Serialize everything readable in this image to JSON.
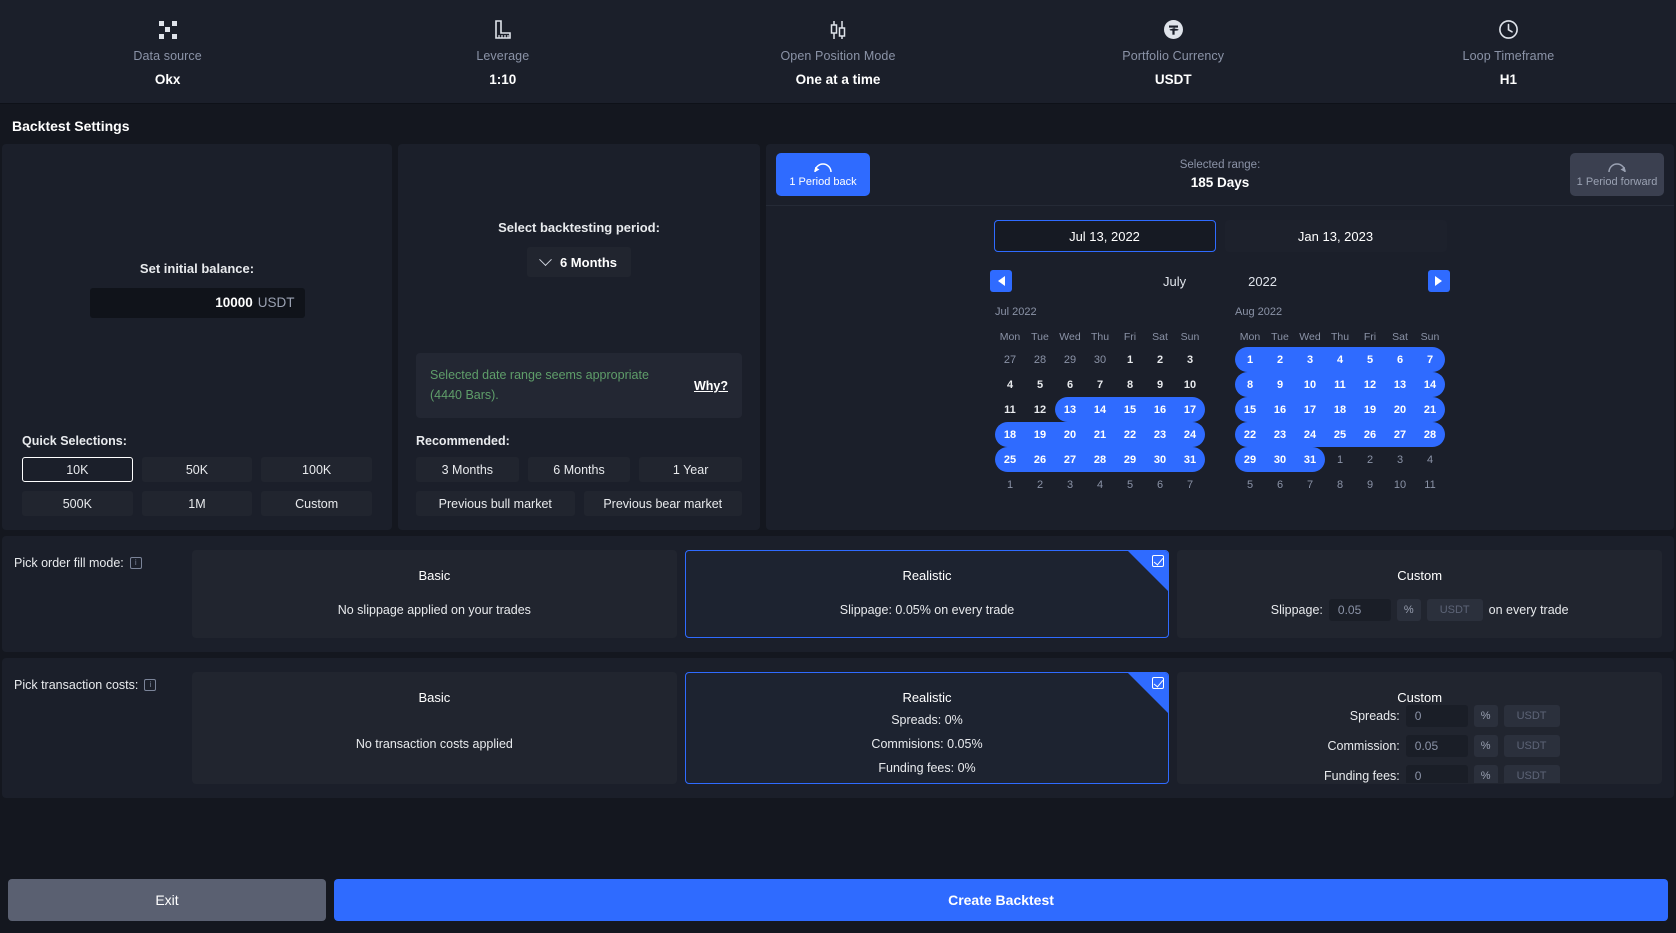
{
  "topbar": {
    "items": [
      {
        "icon": "checkerboard-icon",
        "label": "Data source",
        "value": "Okx"
      },
      {
        "icon": "ruler-icon",
        "label": "Leverage",
        "value": "1:10"
      },
      {
        "icon": "candlestick-icon",
        "label": "Open Position Mode",
        "value": "One at a time"
      },
      {
        "icon": "tether-icon",
        "label": "Portfolio Currency",
        "value": "USDT"
      },
      {
        "icon": "clock-icon",
        "label": "Loop Timeframe",
        "value": "H1"
      }
    ]
  },
  "page_title": "Backtest Settings",
  "balance": {
    "label": "Set initial balance:",
    "value": "10000",
    "currency": "USDT",
    "quick_title": "Quick Selections:",
    "quick_options": [
      "10K",
      "50K",
      "100K",
      "500K",
      "1M",
      "Custom"
    ],
    "selected_quick": "10K"
  },
  "period": {
    "label": "Select backtesting period:",
    "selected": "6 Months",
    "notice_text": "Selected date range seems appropriate (4440 Bars).",
    "notice_link": "Why?",
    "recommended_title": "Recommended:",
    "recommended": [
      "3 Months",
      "6 Months",
      "1 Year",
      "Previous bull market",
      "Previous bear market"
    ]
  },
  "calendar": {
    "period_back": "1 Period back",
    "period_forward": "1 Period forward",
    "range_label": "Selected range:",
    "range_value": "185 Days",
    "start_date": "Jul 13, 2022",
    "end_date": "Jan 13, 2023",
    "nav_month": "July",
    "nav_year": "2022",
    "weekdays": [
      "Mon",
      "Tue",
      "Wed",
      "Thu",
      "Fri",
      "Sat",
      "Sun"
    ],
    "months": [
      {
        "label": "Jul 2022",
        "weeks": [
          [
            {
              "d": "27",
              "s": "dim"
            },
            {
              "d": "28",
              "s": "dim"
            },
            {
              "d": "29",
              "s": "dim"
            },
            {
              "d": "30",
              "s": "dim"
            },
            {
              "d": "1",
              "s": ""
            },
            {
              "d": "2",
              "s": ""
            },
            {
              "d": "3",
              "s": ""
            }
          ],
          [
            {
              "d": "4",
              "s": ""
            },
            {
              "d": "5",
              "s": ""
            },
            {
              "d": "6",
              "s": ""
            },
            {
              "d": "7",
              "s": ""
            },
            {
              "d": "8",
              "s": ""
            },
            {
              "d": "9",
              "s": ""
            },
            {
              "d": "10",
              "s": ""
            }
          ],
          [
            {
              "d": "11",
              "s": ""
            },
            {
              "d": "12",
              "s": ""
            },
            {
              "d": "13",
              "s": "on sleft"
            },
            {
              "d": "14",
              "s": "on"
            },
            {
              "d": "15",
              "s": "on"
            },
            {
              "d": "16",
              "s": "on"
            },
            {
              "d": "17",
              "s": "on sright"
            }
          ],
          [
            {
              "d": "18",
              "s": "on sleft"
            },
            {
              "d": "19",
              "s": "on"
            },
            {
              "d": "20",
              "s": "on"
            },
            {
              "d": "21",
              "s": "on"
            },
            {
              "d": "22",
              "s": "on"
            },
            {
              "d": "23",
              "s": "on"
            },
            {
              "d": "24",
              "s": "on sright"
            }
          ],
          [
            {
              "d": "25",
              "s": "on sleft"
            },
            {
              "d": "26",
              "s": "on"
            },
            {
              "d": "27",
              "s": "on"
            },
            {
              "d": "28",
              "s": "on"
            },
            {
              "d": "29",
              "s": "on"
            },
            {
              "d": "30",
              "s": "on"
            },
            {
              "d": "31",
              "s": "on sright"
            }
          ],
          [
            {
              "d": "1",
              "s": "dim"
            },
            {
              "d": "2",
              "s": "dim"
            },
            {
              "d": "3",
              "s": "dim"
            },
            {
              "d": "4",
              "s": "dim"
            },
            {
              "d": "5",
              "s": "dim"
            },
            {
              "d": "6",
              "s": "dim"
            },
            {
              "d": "7",
              "s": "dim"
            }
          ]
        ]
      },
      {
        "label": "Aug 2022",
        "weeks": [
          [
            {
              "d": "1",
              "s": "on sleft"
            },
            {
              "d": "2",
              "s": "on"
            },
            {
              "d": "3",
              "s": "on"
            },
            {
              "d": "4",
              "s": "on"
            },
            {
              "d": "5",
              "s": "on"
            },
            {
              "d": "6",
              "s": "on"
            },
            {
              "d": "7",
              "s": "on sright"
            }
          ],
          [
            {
              "d": "8",
              "s": "on sleft"
            },
            {
              "d": "9",
              "s": "on"
            },
            {
              "d": "10",
              "s": "on"
            },
            {
              "d": "11",
              "s": "on"
            },
            {
              "d": "12",
              "s": "on"
            },
            {
              "d": "13",
              "s": "on"
            },
            {
              "d": "14",
              "s": "on sright"
            }
          ],
          [
            {
              "d": "15",
              "s": "on sleft"
            },
            {
              "d": "16",
              "s": "on"
            },
            {
              "d": "17",
              "s": "on"
            },
            {
              "d": "18",
              "s": "on"
            },
            {
              "d": "19",
              "s": "on"
            },
            {
              "d": "20",
              "s": "on"
            },
            {
              "d": "21",
              "s": "on sright"
            }
          ],
          [
            {
              "d": "22",
              "s": "on sleft"
            },
            {
              "d": "23",
              "s": "on"
            },
            {
              "d": "24",
              "s": "on"
            },
            {
              "d": "25",
              "s": "on"
            },
            {
              "d": "26",
              "s": "on"
            },
            {
              "d": "27",
              "s": "on"
            },
            {
              "d": "28",
              "s": "on sright"
            }
          ],
          [
            {
              "d": "29",
              "s": "on sleft"
            },
            {
              "d": "30",
              "s": "on"
            },
            {
              "d": "31",
              "s": "on sright"
            },
            {
              "d": "1",
              "s": "dim"
            },
            {
              "d": "2",
              "s": "dim"
            },
            {
              "d": "3",
              "s": "dim"
            },
            {
              "d": "4",
              "s": "dim"
            }
          ],
          [
            {
              "d": "5",
              "s": "dim"
            },
            {
              "d": "6",
              "s": "dim"
            },
            {
              "d": "7",
              "s": "dim"
            },
            {
              "d": "8",
              "s": "dim"
            },
            {
              "d": "9",
              "s": "dim"
            },
            {
              "d": "10",
              "s": "dim"
            },
            {
              "d": "11",
              "s": "dim"
            }
          ]
        ]
      }
    ]
  },
  "fill_mode": {
    "band_label": "Pick order fill mode:",
    "basic_title": "Basic",
    "basic_desc": "No slippage applied on your trades",
    "realistic_title": "Realistic",
    "realistic_desc": "Slippage: 0.05% on every trade",
    "custom_title": "Custom",
    "custom_label": "Slippage:",
    "custom_value": "0.05",
    "custom_pct": "%",
    "custom_unit": "USDT",
    "custom_suffix": "on every trade",
    "selected": "Realistic"
  },
  "transaction_costs": {
    "band_label": "Pick transaction costs:",
    "basic_title": "Basic",
    "basic_desc": "No transaction costs applied",
    "realistic_title": "Realistic",
    "realistic_lines": [
      "Spreads: 0%",
      "Commisions: 0.05%",
      "Funding fees: 0%"
    ],
    "custom_title": "Custom",
    "custom_rows": [
      {
        "label": "Spreads:",
        "value": "0",
        "pct": "%",
        "unit": "USDT"
      },
      {
        "label": "Commission:",
        "value": "0.05",
        "pct": "%",
        "unit": "USDT"
      },
      {
        "label": "Funding fees:",
        "value": "0",
        "pct": "%",
        "unit": "USDT"
      }
    ],
    "selected": "Realistic"
  },
  "footer": {
    "exit": "Exit",
    "create": "Create Backtest"
  }
}
